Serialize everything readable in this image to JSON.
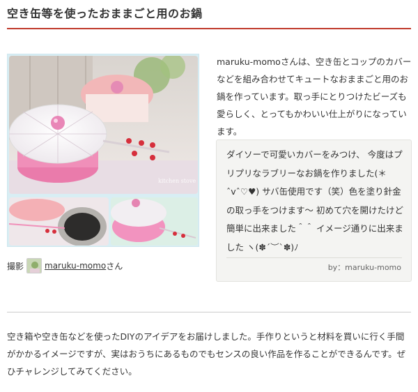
{
  "article": {
    "title": "空き缶等を使ったおままごと用のお鍋",
    "intro": "maruku-momoさんは、空き缶とコップのカバーなどを組み合わせてキュートなおままごと用のお鍋を作っています。取っ手にとりつけたビーズも愛らしく、とってもかわいい仕上がりになっています。"
  },
  "photo": {
    "watermark": "kitchen stove",
    "credit_prefix": "撮影",
    "credit_user": "maruku-momo",
    "credit_suffix": "さん"
  },
  "quote": {
    "text": "ダイソーで可愛いカバーをみつけ、 今度はプリプリなラブリーなお鍋を作りました(＊ˆvˆ♡♥) サバ缶使用です（笑）色を塗り針金の取っ手をつけます〜 初めて穴を開けたけど簡単に出来ました＾＾ イメージ通りに出来ました ヽ(✽´︶`✽)ﾉ",
    "source": "by：maruku-momo"
  },
  "footer": {
    "text": "空き箱や空き缶などを使ったDIYのアイデアをお届けしました。手作りというと材料を買いに行く手間がかかるイメージですが、実はおうちにあるものでもセンスの良い作品を作ることができるんです。ぜひチャレンジしてみてください。"
  },
  "colors": {
    "accent_rule": "#c0392b",
    "quote_bg": "#f4f4f2",
    "photo_frame": "#d8eef4"
  }
}
